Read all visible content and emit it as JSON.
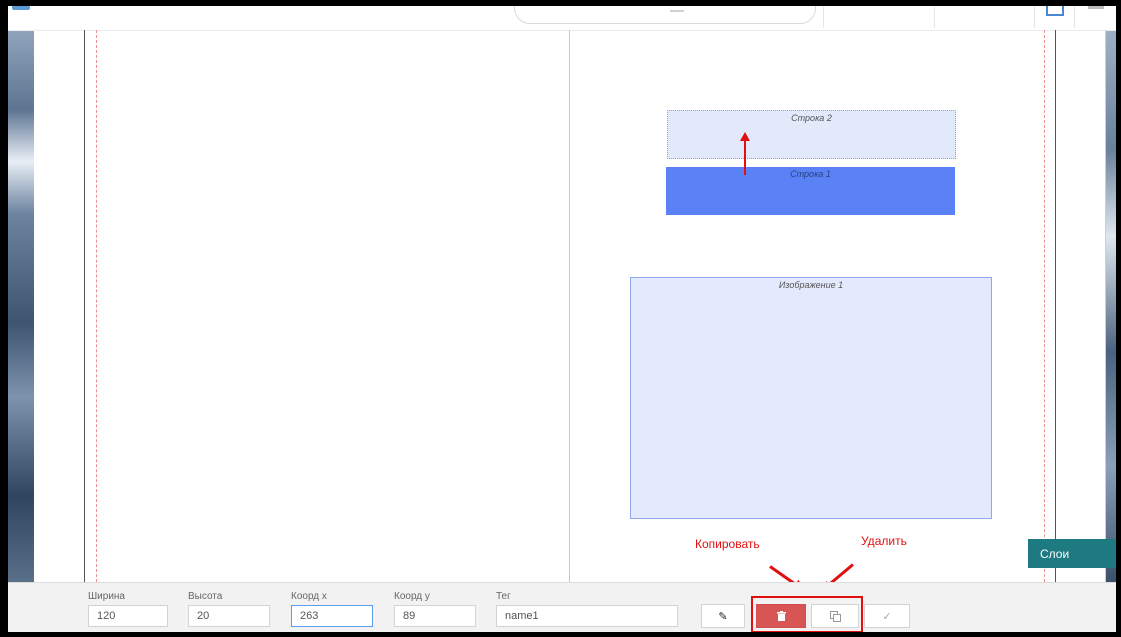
{
  "canvas": {
    "elements": [
      {
        "label": "Строка 2",
        "state": "dragging"
      },
      {
        "label": "Строка 1",
        "state": "selected"
      },
      {
        "label": "Изображение 1",
        "state": "normal"
      }
    ]
  },
  "annotations": {
    "copy_label": "Копировать",
    "delete_label": "Удалить"
  },
  "layers_button": {
    "label": "Слои"
  },
  "properties": {
    "width": {
      "label": "Ширина",
      "value": "120"
    },
    "height": {
      "label": "Высота",
      "value": "20"
    },
    "x": {
      "label": "Коорд x",
      "value": "263"
    },
    "y": {
      "label": "Коорд y",
      "value": "89"
    },
    "tag": {
      "label": "Тег",
      "value": "name1"
    }
  },
  "actions": {
    "edit_icon": "pencil-icon",
    "delete_icon": "trash-icon",
    "copy_icon": "copy-icon",
    "confirm_icon": "check-icon"
  },
  "colors": {
    "selected_fill": "#5a82f6",
    "element_fill": "#e2e9fb",
    "delete_button": "#d85555",
    "layers_button": "#1d7a80",
    "annotation": "#e01010"
  }
}
